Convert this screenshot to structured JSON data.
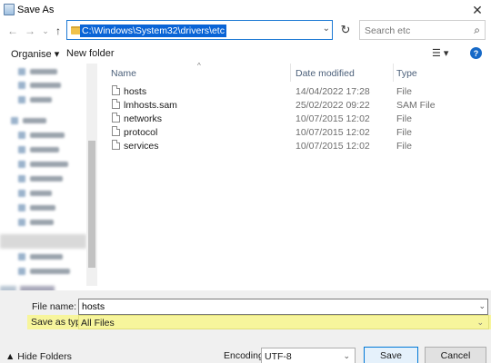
{
  "window": {
    "title": "Save As",
    "close_glyph": "✕"
  },
  "nav": {
    "back_glyph": "←",
    "forward_glyph": "→",
    "recent_glyph": "⌄",
    "up_glyph": "↑",
    "address": "C:\\Windows\\System32\\drivers\\etc",
    "address_dropdown_glyph": "⌄",
    "refresh_glyph": "↻",
    "search_placeholder": "Search etc",
    "search_glyph": "⌕"
  },
  "toolbar": {
    "organise_label": "Organise ▾",
    "new_folder_label": "New folder",
    "view_glyph": "☰ ▾",
    "help_glyph": "?"
  },
  "columns": {
    "name": "Name",
    "date": "Date modified",
    "type": "Type",
    "sort_glyph": "^"
  },
  "files": [
    {
      "name": "hosts",
      "date": "14/04/2022 17:28",
      "type": "File"
    },
    {
      "name": "lmhosts.sam",
      "date": "25/02/2022 09:22",
      "type": "SAM File"
    },
    {
      "name": "networks",
      "date": "10/07/2015 12:02",
      "type": "File"
    },
    {
      "name": "protocol",
      "date": "10/07/2015 12:02",
      "type": "File"
    },
    {
      "name": "services",
      "date": "10/07/2015 12:02",
      "type": "File"
    }
  ],
  "save_form": {
    "file_name_label": "File name:",
    "file_name_value": "hosts",
    "file_name_dropdown_glyph": "⌄",
    "save_as_type_label": "Save as type:",
    "save_as_type_value": "All Files",
    "save_as_type_dropdown_glyph": "⌄",
    "hide_folders_label": "▲ Hide Folders",
    "encoding_label": "Encoding:",
    "encoding_value": "UTF-8",
    "encoding_dropdown_glyph": "⌄",
    "save_button": "Save",
    "cancel_button": "Cancel"
  },
  "colors": {
    "highlight_yellow": "#f7f59c",
    "accent_blue": "#0a64d6"
  }
}
